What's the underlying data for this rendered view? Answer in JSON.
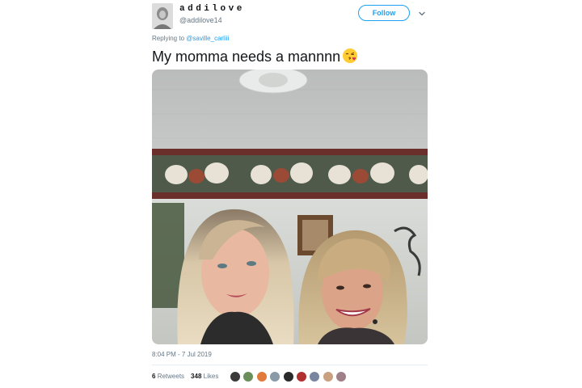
{
  "user": {
    "display_name": "addilove",
    "handle": "@addilove14"
  },
  "follow_label": "Follow",
  "reply": {
    "prefix": "Replying to",
    "mention": "@saville_carliii"
  },
  "tweet": {
    "text": "My momma needs a mannnn",
    "emoji": "face-blowing-kiss-emoji"
  },
  "timestamp": "8:04 PM - 7 Jul 2019",
  "stats": {
    "retweets_count": "6",
    "retweets_label": "Retweets",
    "likes_count": "348",
    "likes_label": "Likes"
  },
  "likers": [
    {
      "icon": "liker-avatar-1",
      "color": "#3a3a3a"
    },
    {
      "icon": "liker-avatar-2",
      "color": "#6b8f5a"
    },
    {
      "icon": "liker-avatar-3",
      "color": "#e07a3a"
    },
    {
      "icon": "liker-avatar-4",
      "color": "#8a9aa6"
    },
    {
      "icon": "liker-avatar-5",
      "color": "#2a2a2a"
    },
    {
      "icon": "liker-avatar-6",
      "color": "#b03030"
    },
    {
      "icon": "liker-avatar-7",
      "color": "#7a86a0"
    },
    {
      "icon": "liker-avatar-8",
      "color": "#c9a080"
    },
    {
      "icon": "liker-avatar-9",
      "color": "#a08088"
    }
  ],
  "colors": {
    "accent": "#1da1f2",
    "secondary_text": "#657786",
    "primary_text": "#14171a"
  }
}
